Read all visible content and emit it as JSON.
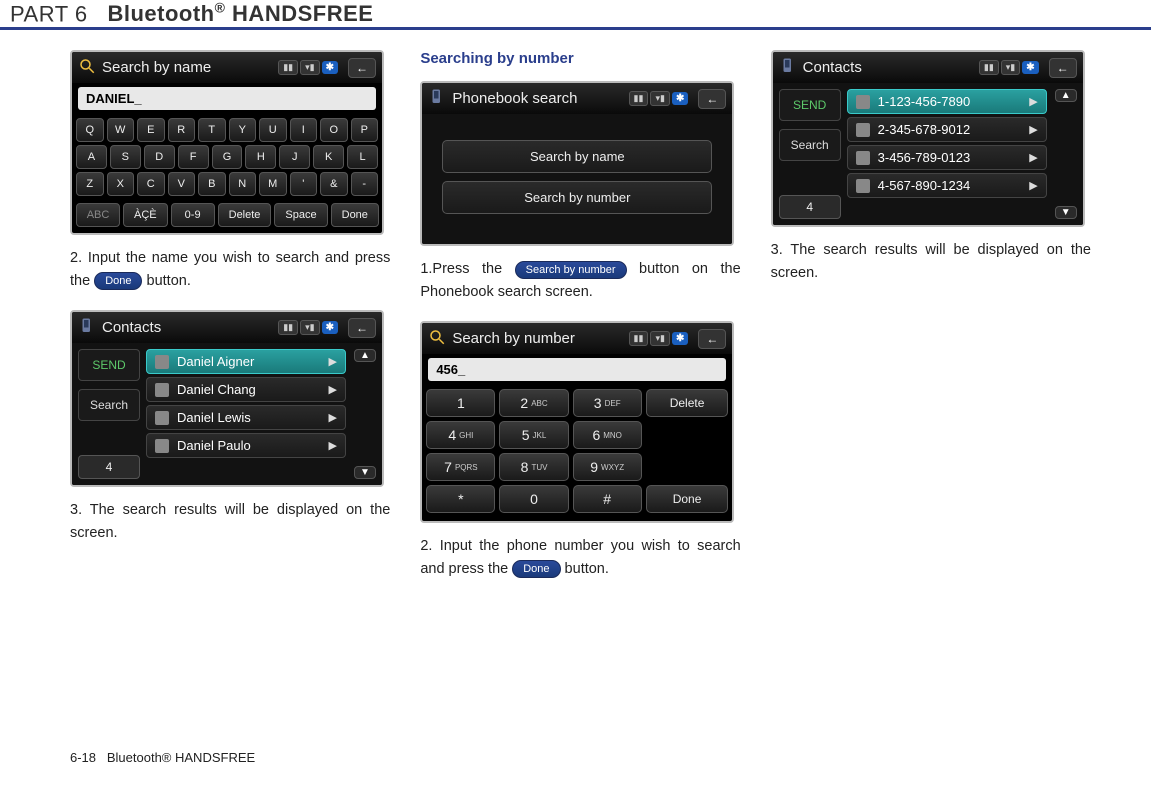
{
  "header": {
    "part": "PART 6",
    "title": "Bluetooth",
    "suffix": "HANDSFREE"
  },
  "footer": {
    "page": "6-18",
    "label": "Bluetooth® HANDSFREE"
  },
  "col1": {
    "shot1": {
      "title": "Search by name",
      "input": "DANIEL_",
      "rows": [
        [
          "Q",
          "W",
          "E",
          "R",
          "T",
          "Y",
          "U",
          "I",
          "O",
          "P"
        ],
        [
          "A",
          "S",
          "D",
          "F",
          "G",
          "H",
          "J",
          "K",
          "L"
        ],
        [
          "Z",
          "X",
          "C",
          "V",
          "B",
          "N",
          "M",
          "'",
          "&",
          "-"
        ]
      ],
      "bottom": {
        "abc": "ABC",
        "accents": "ÀÇÈ",
        "nums": "0-9",
        "delete": "Delete",
        "space": "Space",
        "done": "Done"
      }
    },
    "step2": {
      "pre": "2. Input the name you wish to search and press the ",
      "btn": "Done",
      "post": " button."
    },
    "shot2": {
      "title": "Contacts",
      "send": "SEND",
      "search": "Search",
      "count": "4",
      "rows": [
        {
          "label": "Daniel Aigner",
          "hl": true
        },
        {
          "label": "Daniel Chang",
          "hl": false
        },
        {
          "label": "Daniel Lewis",
          "hl": false
        },
        {
          "label": "Daniel Paulo",
          "hl": false
        }
      ]
    },
    "step3": "3. The search results will be displayed on the screen."
  },
  "col2": {
    "heading": "Searching by number",
    "shot1": {
      "title": "Phonebook search",
      "opt1": "Search by name",
      "opt2": "Search by number"
    },
    "step1": {
      "pre": "1.Press the ",
      "btn": "Search by number",
      "post": " button on the Phonebook search screen."
    },
    "shot2": {
      "title": "Search by number",
      "input": "456_",
      "rows": [
        [
          {
            "d": "1",
            "l": ""
          },
          {
            "d": "2",
            "l": "ABC"
          },
          {
            "d": "3",
            "l": "DEF"
          },
          {
            "side": "Delete"
          }
        ],
        [
          {
            "d": "4",
            "l": "GHI"
          },
          {
            "d": "5",
            "l": "JKL"
          },
          {
            "d": "6",
            "l": "MNO"
          }
        ],
        [
          {
            "d": "7",
            "l": "PQRS"
          },
          {
            "d": "8",
            "l": "TUV"
          },
          {
            "d": "9",
            "l": "WXYZ"
          }
        ],
        [
          {
            "d": "*",
            "l": ""
          },
          {
            "d": "0",
            "l": ""
          },
          {
            "d": "#",
            "l": ""
          },
          {
            "side": "Done"
          }
        ]
      ]
    },
    "step2": {
      "pre": "2. Input the phone number you wish to search and press the ",
      "btn": "Done",
      "post": " button."
    }
  },
  "col3": {
    "shot1": {
      "title": "Contacts",
      "send": "SEND",
      "search": "Search",
      "count": "4",
      "rows": [
        {
          "label": "1-123-456-7890",
          "hl": true
        },
        {
          "label": "2-345-678-9012",
          "hl": false
        },
        {
          "label": "3-456-789-0123",
          "hl": false
        },
        {
          "label": "4-567-890-1234",
          "hl": false
        }
      ]
    },
    "step3": "3. The search results will be displayed on the screen."
  }
}
